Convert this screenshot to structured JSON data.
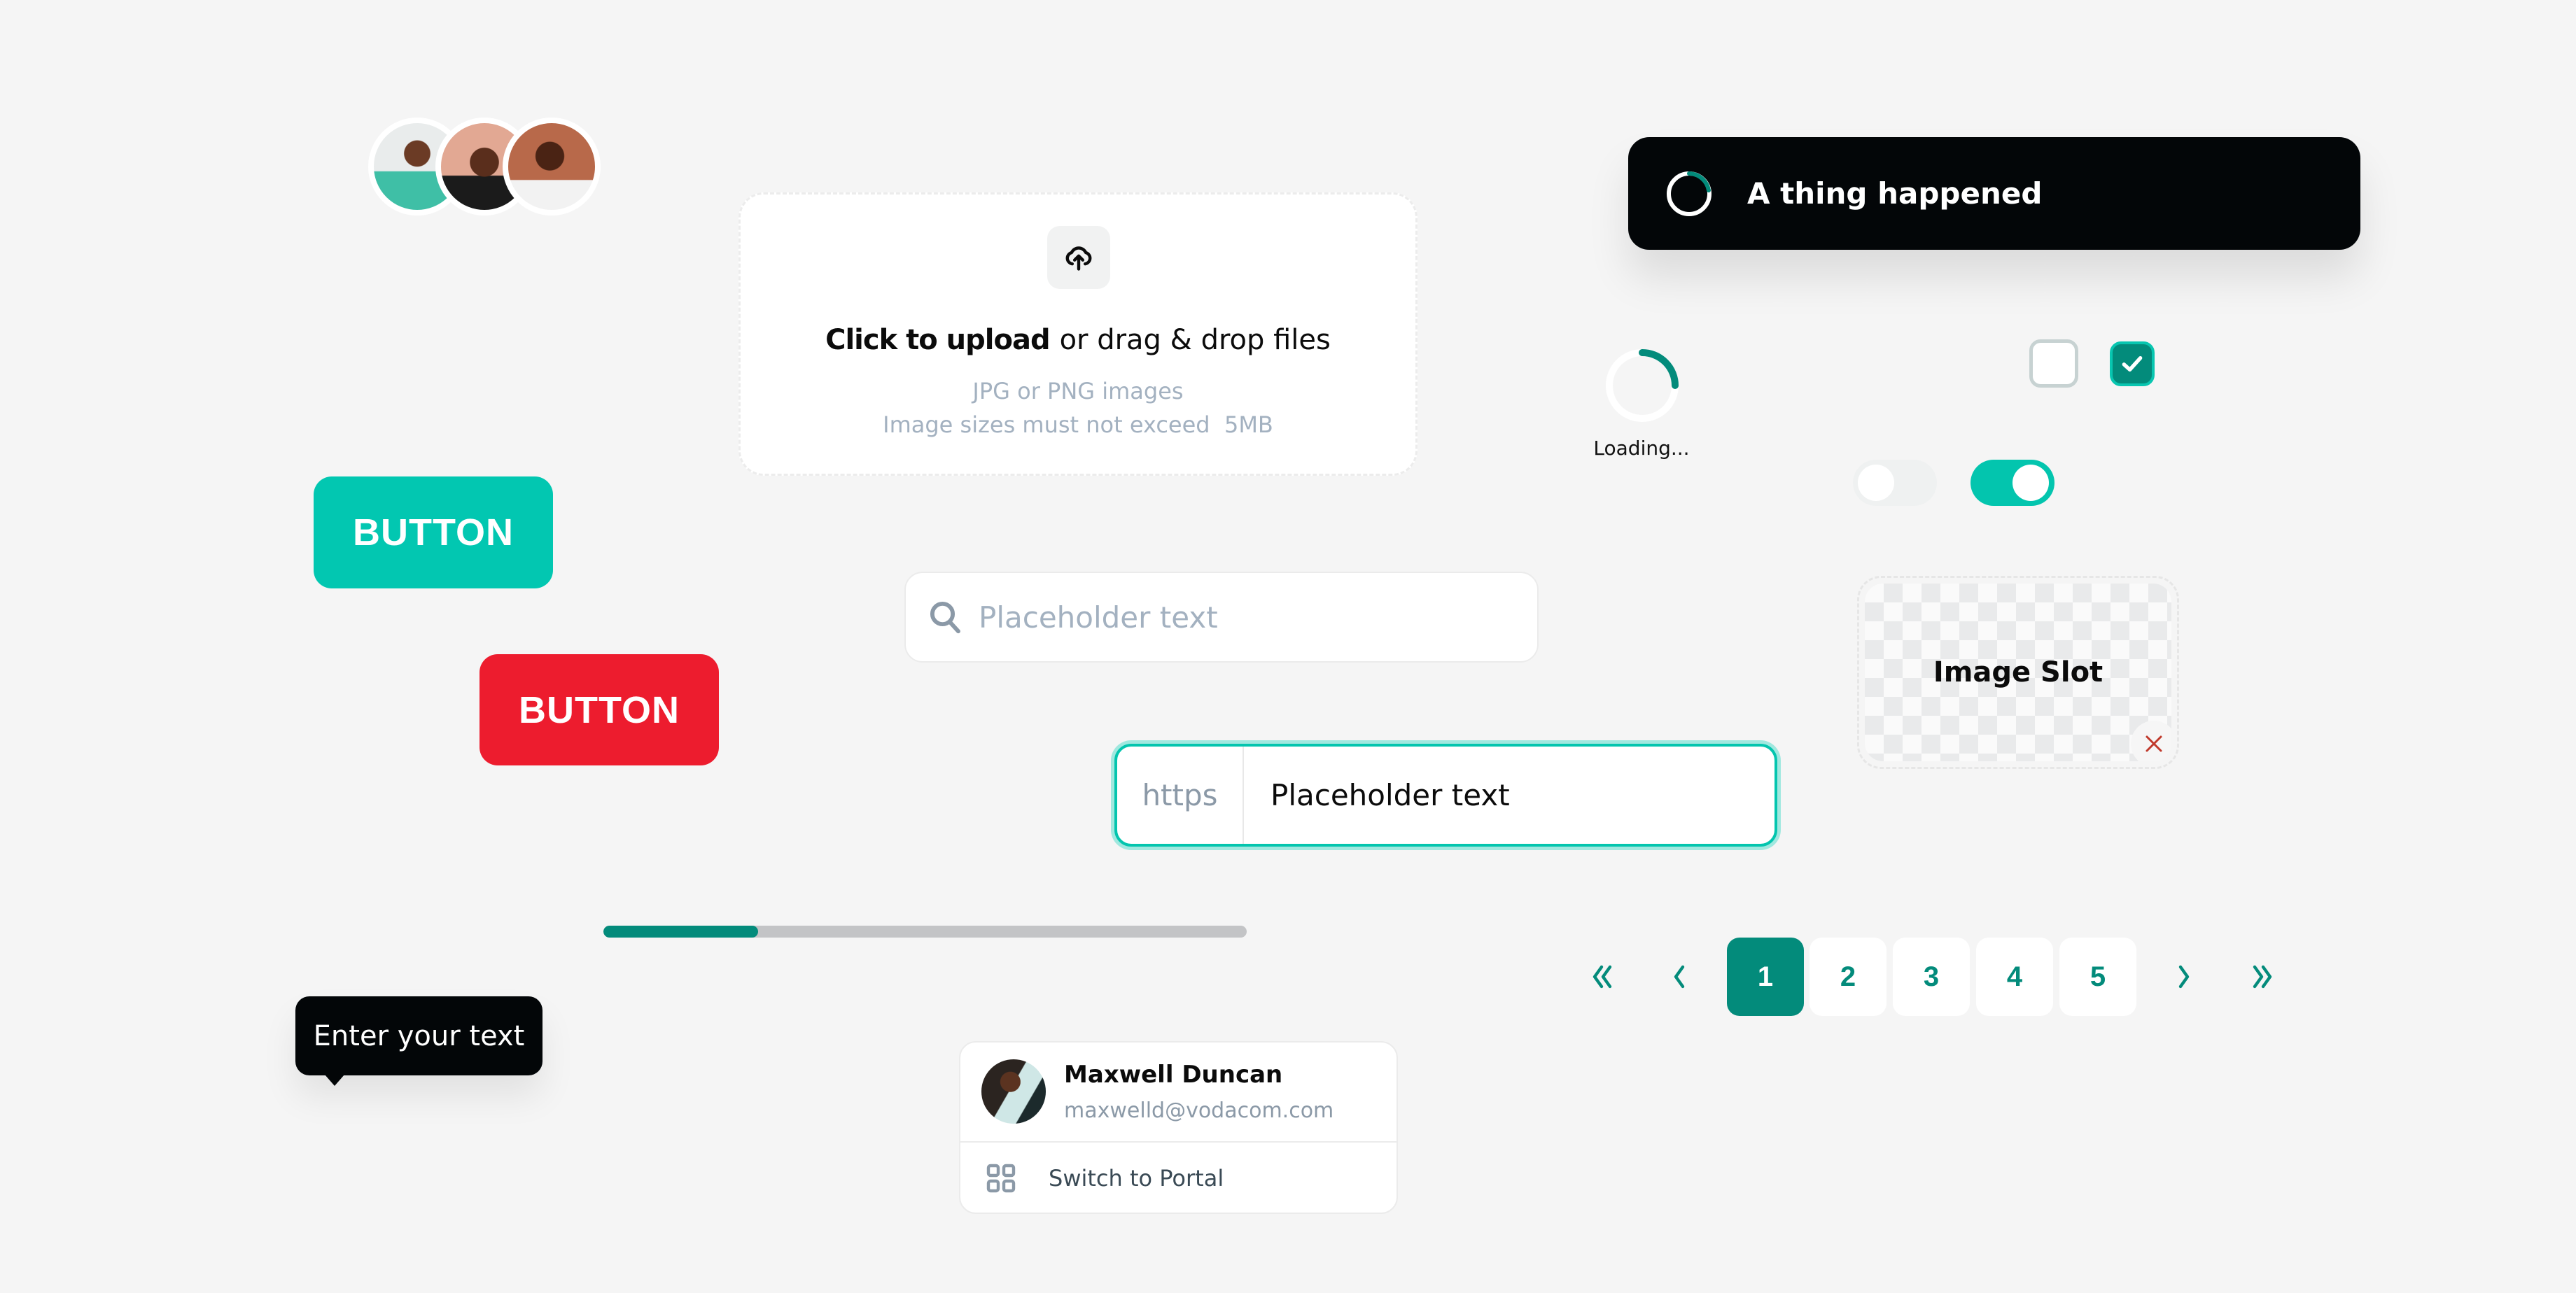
{
  "avatar_group": {
    "avatars": [
      {
        "name": "avatar-person-1"
      },
      {
        "name": "avatar-person-2"
      },
      {
        "name": "avatar-person-3"
      }
    ]
  },
  "upload": {
    "icon": "cloud-upload-icon",
    "cta": "Click to upload",
    "cta_suffix": "or drag & drop files",
    "hint_formats": "JPG or PNG images",
    "hint_size": "Image sizes must not exceed  5MB"
  },
  "toast": {
    "message": "A thing happened",
    "icon": "spinner-icon"
  },
  "loader": {
    "label": "Loading...",
    "progress_fraction": 0.25
  },
  "checkboxes": [
    {
      "checked": false
    },
    {
      "checked": true
    }
  ],
  "toggles": [
    {
      "on": false
    },
    {
      "on": true
    }
  ],
  "buttons": {
    "primary_label": "BUTTON",
    "danger_label": "BUTTON"
  },
  "search": {
    "placeholder": "Placeholder text",
    "icon": "search-icon"
  },
  "url_input": {
    "prefix": "https",
    "placeholder": "Placeholder text"
  },
  "image_slot": {
    "label": "Image Slot",
    "remove_icon": "close-icon"
  },
  "progress": {
    "percent": 24
  },
  "pagination": {
    "first_icon": "double-chevron-left-icon",
    "prev_icon": "chevron-left-icon",
    "next_icon": "chevron-right-icon",
    "last_icon": "double-chevron-right-icon",
    "pages": [
      "1",
      "2",
      "3",
      "4",
      "5"
    ],
    "current": "1"
  },
  "tooltip": {
    "text": "Enter your text"
  },
  "user_card": {
    "name": "Maxwell Duncan",
    "email": "maxwelld@vodacom.com",
    "action_label": "Switch to Portal",
    "action_icon": "grid-icon"
  },
  "colors": {
    "teal": "#02c7b1",
    "teal_dark": "#038b7b",
    "red": "#ed1c2e",
    "dark": "#030608",
    "muted_text": "#a3b1c0",
    "background": "#f5f5f5"
  }
}
